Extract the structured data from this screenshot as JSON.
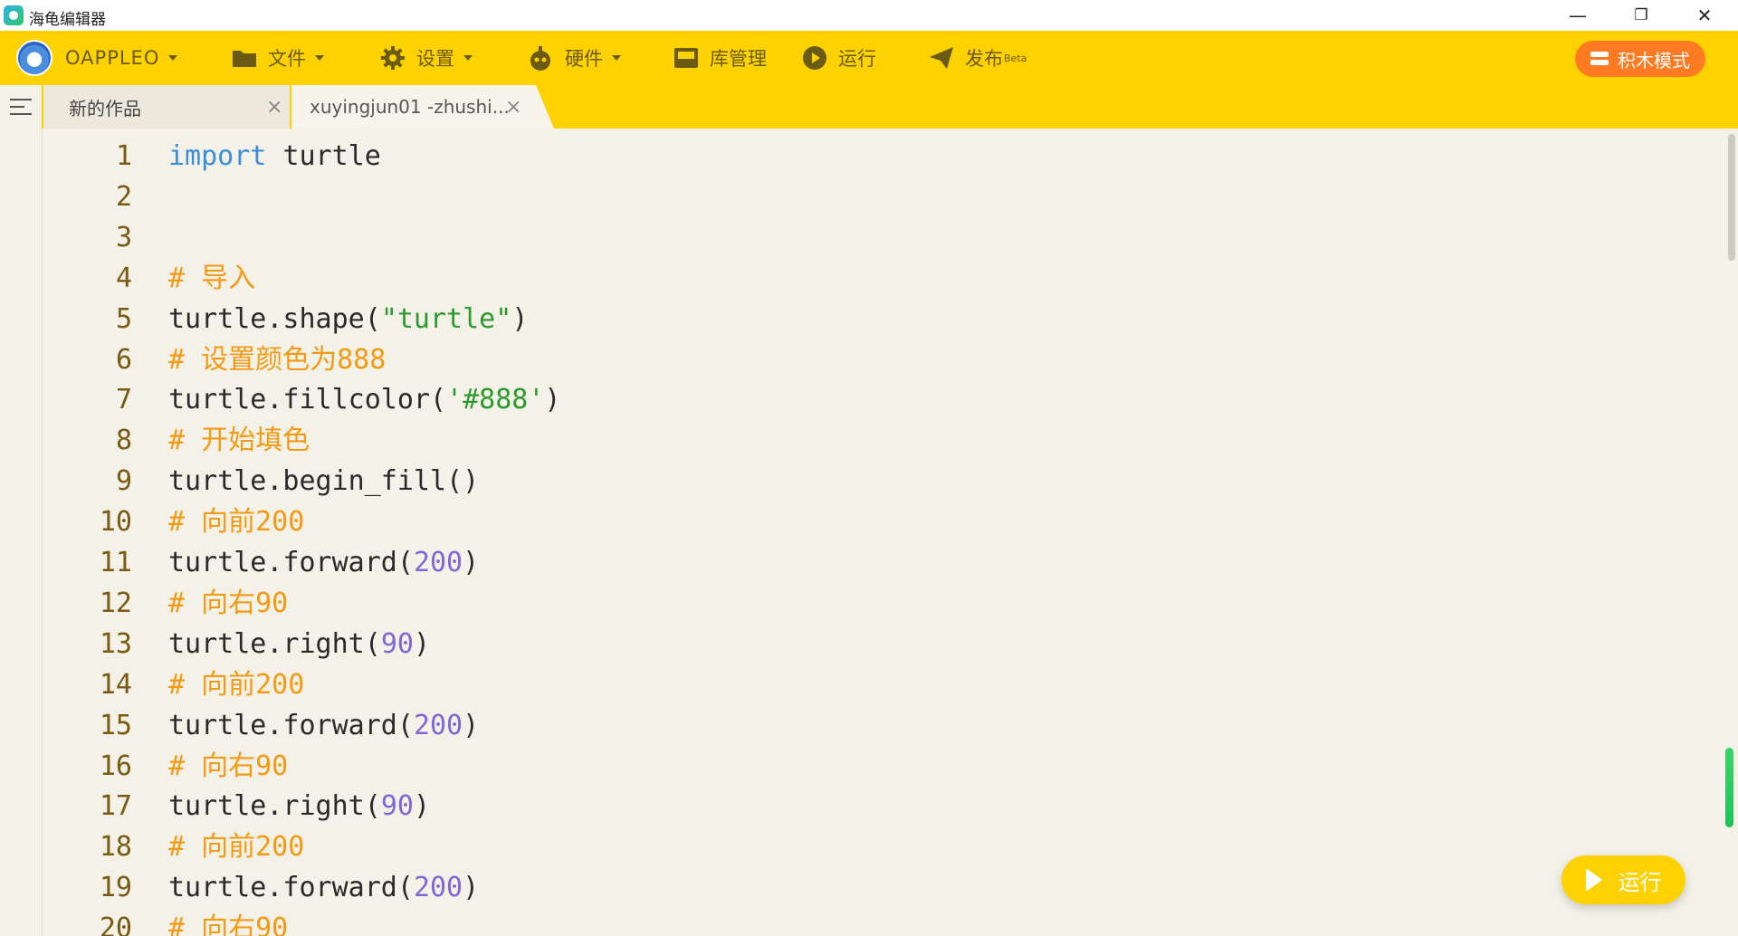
{
  "window": {
    "title": "海龟编辑器",
    "min_glyph": "—",
    "restore_glyph": "❐",
    "close_glyph": "✕"
  },
  "menubar": {
    "user": "OAPPLEO",
    "items": [
      {
        "label": "文件",
        "icon": "folder-icon"
      },
      {
        "label": "设置",
        "icon": "gear-icon"
      },
      {
        "label": "硬件",
        "icon": "robot-icon"
      },
      {
        "label": "库管理",
        "icon": "library-icon"
      },
      {
        "label": "运行",
        "icon": "play-circle-icon"
      },
      {
        "label": "发布",
        "sup": "Beta",
        "icon": "send-icon"
      }
    ],
    "block_mode": "积木模式"
  },
  "tabs": [
    {
      "label": "新的作品",
      "close": "×"
    },
    {
      "label": "xuyingjun01 -zhushi...",
      "close": "×"
    }
  ],
  "editor": {
    "lines": [
      {
        "n": "1",
        "code": [
          [
            "kw",
            "import"
          ],
          [
            "",
            "turtle"
          ]
        ]
      },
      {
        "n": "2",
        "code": []
      },
      {
        "n": "3",
        "code": []
      },
      {
        "n": "4",
        "code": [
          [
            "cm",
            "# 导入"
          ]
        ]
      },
      {
        "n": "5",
        "code": [
          [
            "",
            "turtle.shape("
          ],
          [
            "str",
            "\"turtle\""
          ],
          [
            "",
            ")"
          ]
        ]
      },
      {
        "n": "6",
        "code": [
          [
            "cm",
            "# 设置颜色为888"
          ]
        ]
      },
      {
        "n": "7",
        "code": [
          [
            "",
            "turtle.fillcolor("
          ],
          [
            "str",
            "'#888'"
          ],
          [
            "",
            ")"
          ]
        ]
      },
      {
        "n": "8",
        "code": [
          [
            "cm",
            "# 开始填色"
          ]
        ]
      },
      {
        "n": "9",
        "code": [
          [
            "",
            "turtle.begin_fill()"
          ]
        ]
      },
      {
        "n": "10",
        "code": [
          [
            "cm",
            "# 向前200"
          ]
        ]
      },
      {
        "n": "11",
        "code": [
          [
            "",
            "turtle.forward("
          ],
          [
            "num",
            "200"
          ],
          [
            "",
            ")"
          ]
        ]
      },
      {
        "n": "12",
        "code": [
          [
            "cm",
            "# 向右90"
          ]
        ]
      },
      {
        "n": "13",
        "code": [
          [
            "",
            "turtle.right("
          ],
          [
            "num",
            "90"
          ],
          [
            "",
            ")"
          ]
        ]
      },
      {
        "n": "14",
        "code": [
          [
            "cm",
            "# 向前200"
          ]
        ]
      },
      {
        "n": "15",
        "code": [
          [
            "",
            "turtle.forward("
          ],
          [
            "num",
            "200"
          ],
          [
            "",
            ")"
          ]
        ]
      },
      {
        "n": "16",
        "code": [
          [
            "cm",
            "# 向右90"
          ]
        ]
      },
      {
        "n": "17",
        "code": [
          [
            "",
            "turtle.right("
          ],
          [
            "num",
            "90"
          ],
          [
            "",
            ")"
          ]
        ]
      },
      {
        "n": "18",
        "code": [
          [
            "cm",
            "# 向前200"
          ]
        ]
      },
      {
        "n": "19",
        "code": [
          [
            "",
            "turtle.forward("
          ],
          [
            "num",
            "200"
          ],
          [
            "",
            ")"
          ]
        ]
      },
      {
        "n": "20",
        "code": [
          [
            "cm",
            "# 向右90"
          ]
        ]
      }
    ]
  },
  "run_button": "运行",
  "colors": {
    "accent": "#fdd200",
    "block_mode": "#ff7a21",
    "keyword": "#3a8dd8",
    "comment": "#f39a12",
    "string": "#2c9a2c",
    "number": "#7b6ad6"
  }
}
